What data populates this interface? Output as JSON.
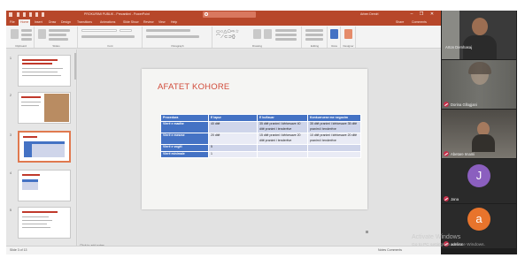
{
  "window": {
    "doc_title": "PROKURIMI PUBLIK - Prezantimi - PowerPoint",
    "user_name": "Arben Demiri",
    "window_controls": [
      "–",
      "❐",
      "✕"
    ],
    "accent": "#b7472a"
  },
  "ribbon": {
    "tabs": [
      "File",
      "Home",
      "Insert",
      "Draw",
      "Design",
      "Transitions",
      "Animations",
      "Slide Show",
      "Review",
      "View",
      "Help"
    ],
    "active_tab": "Home",
    "share_label": "Share",
    "comments_label": "Comments",
    "groups": [
      "Clipboard",
      "Slides",
      "Font",
      "Paragraph",
      "Drawing",
      "Editing",
      "Voice",
      "Designer"
    ]
  },
  "thumbnails": {
    "numbers": [
      "1",
      "2",
      "3",
      "4",
      "5"
    ],
    "selected": "3"
  },
  "slide": {
    "title": "AFATET KOHORE",
    "table": {
      "header": [
        "Procedura",
        "E lapur",
        "E kufizuar",
        "Konkurruese me negocim"
      ],
      "rows": [
        {
          "label": "Vlerë e madhe",
          "cells": [
            "40 ditë",
            "35 ditë pranimi i kërkesave 40 ditë pranimi i tenderëve",
            "35 ditë pranimi i kërkesave 35 ditë pranimi i tenderëve"
          ]
        },
        {
          "label": "Vlerë e mesme",
          "cells": [
            "20 ditë",
            "15 ditë pranimi i kërkesave 20 ditë pranimi i tenderëve",
            "10 ditë pranimi i kërkesave 20 ditë pranimi i tenderëve"
          ]
        },
        {
          "label": "Vlerë e vogël",
          "cells": [
            "5",
            "",
            ""
          ]
        },
        {
          "label": "Vlerë minimale",
          "cells": [
            "1",
            "",
            ""
          ]
        }
      ],
      "header_color": "#4472c4",
      "band_dark": "#cfd5ea",
      "band_light": "#e9ebf5"
    },
    "title_color": "#d14b3a"
  },
  "editor": {
    "notes_placeholder": "Click to add notes",
    "status_left": "Slide 3 of 13",
    "status_right": "Notes   Comments"
  },
  "watermark": {
    "title": "Activate Windows",
    "subtitle": "Go to PC settings to activate Windows."
  },
  "participants": [
    {
      "name": "Arton Demhasaj",
      "type": "video",
      "muted": false
    },
    {
      "name": "Dorina Gllogjani",
      "type": "video",
      "muted": true
    },
    {
      "name": "Abetare Imami",
      "type": "video",
      "muted": true
    },
    {
      "name": "Jana",
      "type": "avatar",
      "initial": "J",
      "color": "#8b5fbf",
      "muted": true
    },
    {
      "name": "adelina",
      "type": "avatar",
      "initial": "a",
      "color": "#e8742c",
      "muted": true
    }
  ]
}
